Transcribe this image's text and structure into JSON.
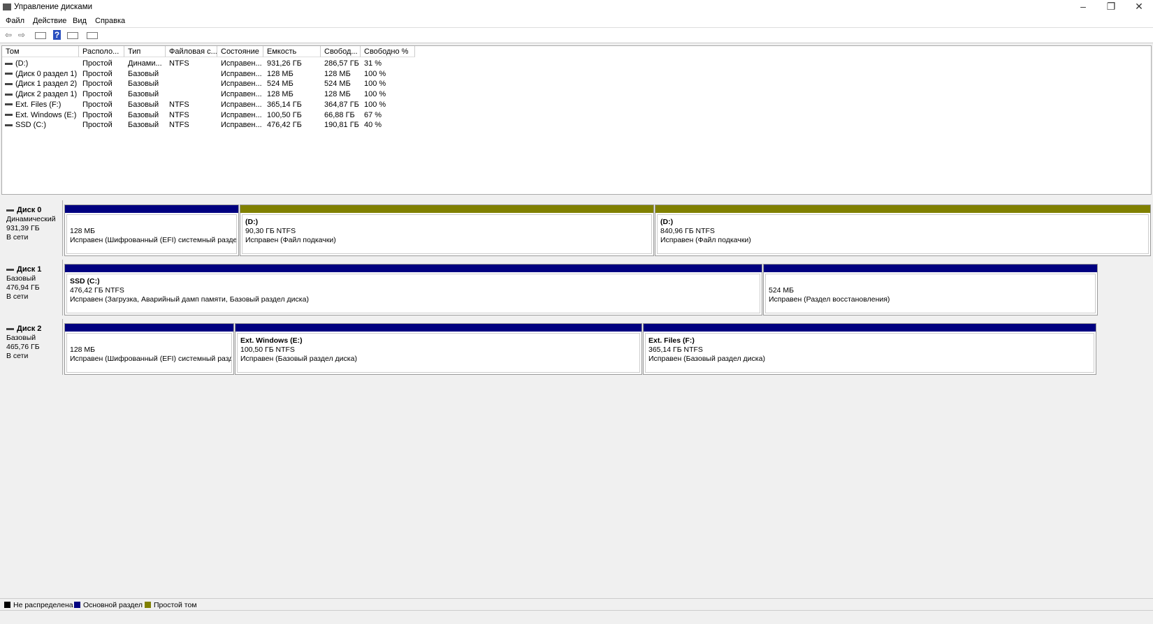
{
  "window": {
    "title": "Управление дисками",
    "minimize": "–",
    "restore": "❐",
    "close": "✕"
  },
  "menu": [
    "Файл",
    "Действие",
    "Вид",
    "Справка"
  ],
  "table": {
    "columns": [
      "Том",
      "Располо...",
      "Тип",
      "Файловая с...",
      "Состояние",
      "Емкость",
      "Свобод...",
      "Свободно %"
    ],
    "rows": [
      [
        "(D:)",
        "Простой",
        "Динами...",
        "NTFS",
        "Исправен...",
        "931,26 ГБ",
        "286,57 ГБ",
        "31 %"
      ],
      [
        "(Диск 0 раздел 1)",
        "Простой",
        "Базовый",
        "",
        "Исправен...",
        "128 МБ",
        "128 МБ",
        "100 %"
      ],
      [
        "(Диск 1 раздел 2)",
        "Простой",
        "Базовый",
        "",
        "Исправен...",
        "524 МБ",
        "524 МБ",
        "100 %"
      ],
      [
        "(Диск 2 раздел 1)",
        "Простой",
        "Базовый",
        "",
        "Исправен...",
        "128 МБ",
        "128 МБ",
        "100 %"
      ],
      [
        "Ext. Files (F:)",
        "Простой",
        "Базовый",
        "NTFS",
        "Исправен...",
        "365,14 ГБ",
        "364,87 ГБ",
        "100 %"
      ],
      [
        "Ext. Windows (E:)",
        "Простой",
        "Базовый",
        "NTFS",
        "Исправен...",
        "100,50 ГБ",
        "66,88 ГБ",
        "67 %"
      ],
      [
        "SSD (C:)",
        "Простой",
        "Базовый",
        "NTFS",
        "Исправен...",
        "476,42 ГБ",
        "190,81 ГБ",
        "40 %"
      ]
    ]
  },
  "disks": [
    {
      "name": "Диск 0",
      "type": "Динамический",
      "size": "931,39 ГБ",
      "status": "В сети",
      "partitions": [
        {
          "name": "",
          "size": "128 МБ",
          "status": "Исправен (Шифрованный (EFI) системный раздел)",
          "kind": "primary"
        },
        {
          "name": "(D:)",
          "size": "90,30 ГБ NTFS",
          "status": "Исправен (Файл подкачки)",
          "kind": "simple"
        },
        {
          "name": "(D:)",
          "size": "840,96 ГБ NTFS",
          "status": "Исправен (Файл подкачки)",
          "kind": "simple"
        }
      ]
    },
    {
      "name": "Диск 1",
      "type": "Базовый",
      "size": "476,94 ГБ",
      "status": "В сети",
      "partitions": [
        {
          "name": "SSD  (C:)",
          "size": "476,42 ГБ NTFS",
          "status": "Исправен (Загрузка, Аварийный дамп памяти, Базовый раздел диска)",
          "kind": "primary"
        },
        {
          "name": "",
          "size": "524 МБ",
          "status": "Исправен (Раздел восстановления)",
          "kind": "primary"
        }
      ]
    },
    {
      "name": "Диск 2",
      "type": "Базовый",
      "size": "465,76 ГБ",
      "status": "В сети",
      "partitions": [
        {
          "name": "",
          "size": "128 МБ",
          "status": "Исправен (Шифрованный (EFI) системный раздел)",
          "kind": "primary"
        },
        {
          "name": "Ext. Windows  (E:)",
          "size": "100,50 ГБ NTFS",
          "status": "Исправен (Базовый раздел диска)",
          "kind": "primary"
        },
        {
          "name": "Ext. Files  (F:)",
          "size": "365,14 ГБ NTFS",
          "status": "Исправен (Базовый раздел диска)",
          "kind": "primary"
        }
      ]
    }
  ],
  "legend": [
    {
      "label": "Не распределена",
      "color": "#000000"
    },
    {
      "label": "Основной раздел",
      "color": "#000080"
    },
    {
      "label": "Простой том",
      "color": "#808000"
    }
  ]
}
